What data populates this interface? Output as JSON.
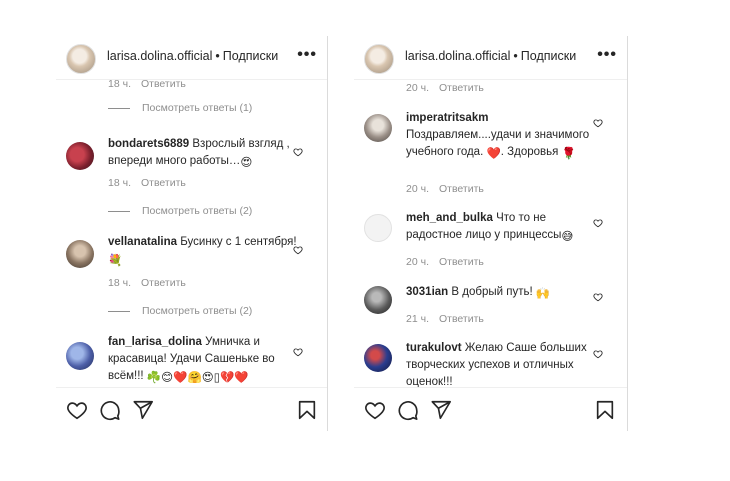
{
  "left": {
    "header": {
      "username": "larisa.dolina.official",
      "separator": "•",
      "follow": "Подписки",
      "more": "•••"
    },
    "top_meta": {
      "time": "18 ч.",
      "reply": "Ответить"
    },
    "view_replies_1": "Посмотреть ответы (1)",
    "comments": [
      {
        "user": "bondarets6889",
        "text": "Взрослый взгляд , впереди много работы…",
        "emojis": "😍",
        "time": "18 ч.",
        "reply": "Ответить",
        "view_replies": "Посмотреть ответы (2)"
      },
      {
        "user": "vellanatalina",
        "text": "Бусинку с 1 сентября!",
        "emojis": "💐",
        "time": "18 ч.",
        "reply": "Ответить",
        "view_replies": "Посмотреть ответы (2)"
      },
      {
        "user": "fan_larisa_dolina",
        "text": "Умничка и красавица! Удачи Сашеньке во всём!!!",
        "emojis": "☘️😊❤️🤗😍▯💔❤️"
      }
    ]
  },
  "right": {
    "header": {
      "username": "larisa.dolina.official",
      "separator": "•",
      "follow": "Подписки",
      "more": "•••"
    },
    "top_meta": {
      "time": "20 ч.",
      "reply": "Ответить"
    },
    "comments": [
      {
        "user": "imperatritsakm",
        "text": "Поздравляем....удачи и значимого учебного года.",
        "emojis": "❤️",
        "text2": ". Здоровья",
        "emojis2": "🌹",
        "time": "20 ч.",
        "reply": "Ответить"
      },
      {
        "user": "meh_and_bulka",
        "text": "Что то не радостное лицо у принцессы",
        "emojis": "😅",
        "time": "20 ч.",
        "reply": "Ответить"
      },
      {
        "user": "3031ian",
        "text": "В добрый путь!",
        "emojis": "🙌",
        "time": "21 ч.",
        "reply": "Ответить"
      },
      {
        "user": "turakulovt",
        "text": "Желаю Саше больших творческих успехов и отличных оценок!!!"
      }
    ]
  },
  "colors": {
    "text": "#262626",
    "secondary": "#8e8e8e",
    "border": "#dbdbdb",
    "like_red": "#ed4956"
  }
}
